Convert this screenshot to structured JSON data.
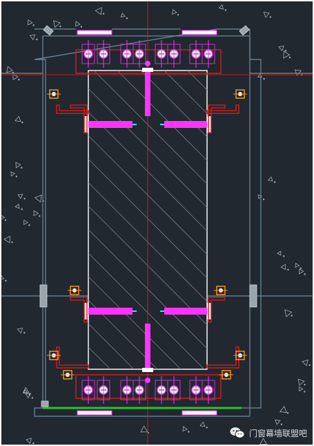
{
  "watermark": {
    "text": "门窗幕墙联盟吧",
    "icon": "wechat-icon"
  },
  "colors": {
    "background": "#212830",
    "axis": "#c81e1e",
    "bracket": "#d01a1a",
    "bolt": "#ff33ff",
    "fixing": "#cc33cc",
    "glass": "#e8e8e8",
    "outline": "#6f8ca0",
    "bottom_line": "#20cc20",
    "accent": "#ff9a1e",
    "cyan": "#33e0ff"
  }
}
